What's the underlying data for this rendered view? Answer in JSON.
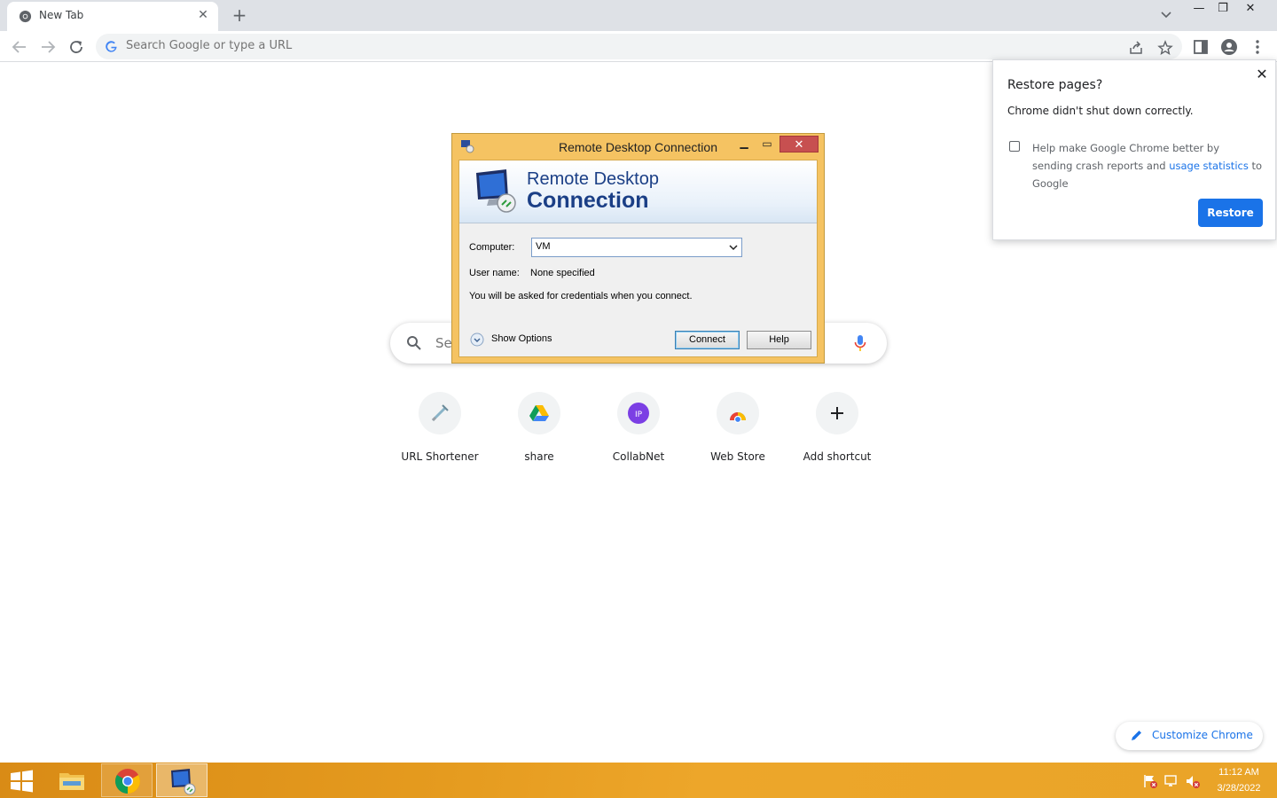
{
  "browser": {
    "tab": {
      "title": "New Tab"
    },
    "omnibox": {
      "placeholder": "Search Google or type a URL"
    }
  },
  "ntp": {
    "search_placeholder": "Se",
    "shortcuts": [
      {
        "label": "URL Shortener",
        "icon": "url-shortener-icon"
      },
      {
        "label": "share",
        "icon": "google-drive-icon"
      },
      {
        "label": "CollabNet",
        "icon": "collabnet-icon",
        "badge": "IP"
      },
      {
        "label": "Web Store",
        "icon": "web-store-icon"
      },
      {
        "label": "Add shortcut",
        "icon": "plus-icon"
      }
    ],
    "customize_label": "Customize Chrome"
  },
  "restore_bubble": {
    "title": "Restore pages?",
    "message": "Chrome didn't shut down correctly.",
    "checkbox_text_before": "Help make Google Chrome better by sending crash reports and ",
    "checkbox_link": "usage statistics",
    "checkbox_text_after": " to Google",
    "checkbox_checked": false,
    "button_label": "Restore",
    "accent": "#1a73e8"
  },
  "rdp_dialog": {
    "window_title": "Remote Desktop Connection",
    "banner_line1": "Remote Desktop",
    "banner_line2": "Connection",
    "computer_label": "Computer:",
    "computer_value": "VM",
    "username_label": "User name:",
    "username_value": "None specified",
    "note": "You will be asked for credentials when you connect.",
    "show_options_label": "Show Options",
    "connect_label": "Connect",
    "help_label": "Help"
  },
  "taskbar": {
    "clock_time": "11:12 AM",
    "clock_date": "3/28/2022",
    "color": "#e59b1f"
  }
}
